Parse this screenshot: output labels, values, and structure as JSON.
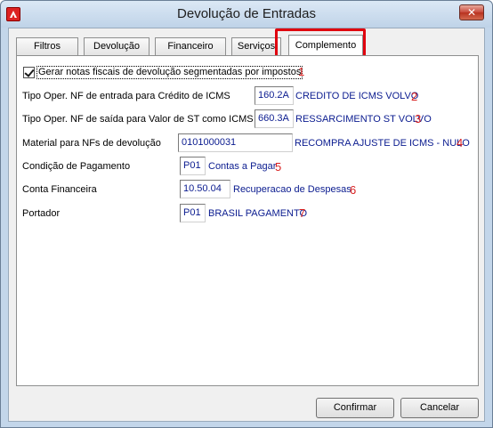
{
  "window": {
    "title": "Devolução de Entradas",
    "close_label": "✕"
  },
  "tabs": [
    {
      "label": "Filtros"
    },
    {
      "label": "Devolução"
    },
    {
      "label": "Financeiro"
    },
    {
      "label": "Serviços"
    },
    {
      "label": "Complemento",
      "active": true
    }
  ],
  "complemento": {
    "checkbox": {
      "label": "Gerar notas fiscais de devolução segmentadas por impostos",
      "checked": true,
      "number": "1"
    },
    "rows": [
      {
        "label": "Tipo Oper. NF de entrada para Crédito de ICMS",
        "code": "160.2A",
        "description": "CREDITO DE ICMS VOLVO",
        "number": "2"
      },
      {
        "label": "Tipo Oper. NF de saída para Valor de ST como ICMS",
        "code": "660.3A",
        "description": "RESSARCIMENTO ST VOLVO",
        "number": "3"
      },
      {
        "label": "Material para NFs de devolução",
        "code": "0101000031",
        "description": "RECOMPRA AJUSTE DE ICMS - NULO",
        "number": "4"
      },
      {
        "label": "Condição de Pagamento",
        "code": "P01",
        "description": "Contas a Pagar",
        "number": "5"
      },
      {
        "label": "Conta Financeira",
        "code": "10.50.04",
        "description": "Recuperacao de Despesas",
        "number": "6"
      },
      {
        "label": "Portador",
        "code": "P01",
        "description": "BRASIL PAGAMENTO",
        "number": "7"
      }
    ]
  },
  "buttons": {
    "confirm": "Confirmar",
    "cancel": "Cancelar"
  },
  "colors": {
    "highlight": "#e0000e",
    "annotation": "#d81f1f",
    "value_text": "#0a1b8f"
  }
}
